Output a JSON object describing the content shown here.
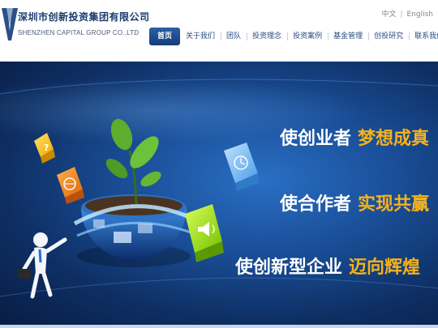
{
  "header": {
    "logo_cn": "深圳市创新投资集团有限公司",
    "logo_en": "SHENZHEN CAPITAL GROUP CO.,LTD",
    "lang_cn": "中文",
    "lang_sep": "|",
    "lang_en": "English"
  },
  "nav": {
    "items": [
      {
        "label": "首页"
      },
      {
        "label": "关于我们"
      },
      {
        "label": "团队"
      },
      {
        "label": "投资理念"
      },
      {
        "label": "投资案例"
      },
      {
        "label": "基金管理"
      },
      {
        "label": "创投研究"
      },
      {
        "label": "联系我们"
      }
    ],
    "active_index": 0
  },
  "banner": {
    "slogans": [
      {
        "white": "使创业者",
        "yellow": "梦想成真"
      },
      {
        "white": "使合作者",
        "yellow": "实现共赢"
      },
      {
        "white": "使创新型企业",
        "yellow": "迈向辉煌"
      }
    ],
    "cube_icons": [
      "question-icon",
      "globe-icon",
      "clock-icon",
      "speaker-icon"
    ],
    "colors": {
      "accent_yellow": "#f6b21a",
      "nav_blue": "#1f4f91",
      "banner_dark": "#0e2e62"
    }
  }
}
